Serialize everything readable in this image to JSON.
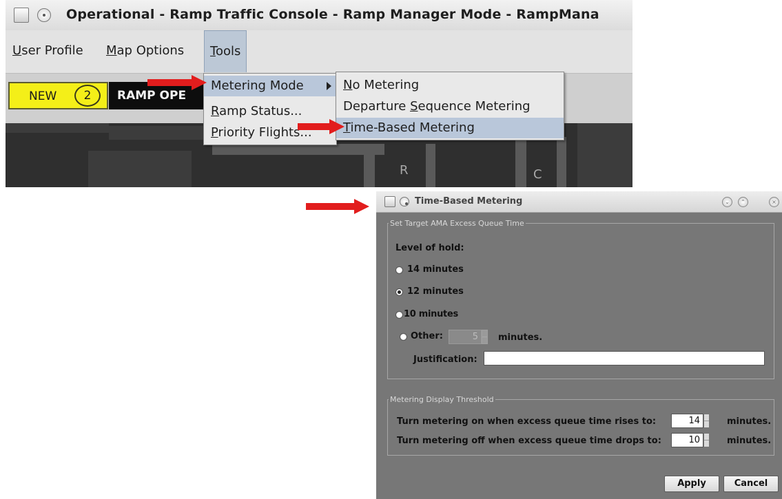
{
  "window": {
    "title": "Operational - Ramp Traffic Console - Ramp Manager Mode - RampMana"
  },
  "menubar": {
    "items": [
      {
        "label": "User Profile",
        "mnemonic": "U"
      },
      {
        "label": "Map Options",
        "mnemonic": "M"
      },
      {
        "label": "Tools",
        "mnemonic": "T"
      }
    ]
  },
  "toolbar": {
    "new_label": "NEW",
    "new_count": "2",
    "ramp_label": "RAMP OPE"
  },
  "map": {
    "labels": [
      "R",
      "C"
    ]
  },
  "tools_menu": {
    "items": [
      {
        "label": "Metering Mode",
        "has_submenu": true
      },
      {
        "label": "Ramp Status..."
      },
      {
        "label": "Priority Flights..."
      }
    ]
  },
  "metering_submenu": {
    "items": [
      {
        "label": "No Metering"
      },
      {
        "label": "Departure Sequence Metering"
      },
      {
        "label": "Time-Based Metering",
        "highlighted": true
      }
    ]
  },
  "dialog": {
    "title": "Time-Based Metering",
    "target_group": {
      "title": "Set Target AMA Excess Queue Time",
      "level_label": "Level of hold:",
      "options": [
        {
          "label": "14 minutes",
          "selected": false
        },
        {
          "label": "12 minutes",
          "selected": true
        },
        {
          "label": "10 minutes",
          "selected": false
        }
      ],
      "other_label": "Other:",
      "other_value": "5",
      "other_unit": "minutes.",
      "justification_label": "Justification:",
      "justification_value": ""
    },
    "threshold_group": {
      "title": "Metering Display Threshold",
      "rows": [
        {
          "label": "Turn metering on when excess queue time rises to:",
          "value": "14",
          "unit": "minutes."
        },
        {
          "label": "Turn metering off when excess queue time drops to:",
          "value": "10",
          "unit": "minutes."
        }
      ]
    },
    "buttons": {
      "apply": "Apply",
      "cancel": "Cancel"
    }
  },
  "colors": {
    "arrow": "#e21d1d",
    "menu_highlight": "#b9c7da",
    "badge_yellow": "#f4ef18",
    "dialog_bg": "#777777"
  },
  "icons": [
    "java-app-icon",
    "window-menu-icon",
    "submenu-arrow-icon",
    "minimize-icon",
    "maximize-icon",
    "close-icon",
    "spinner-up-icon",
    "spinner-down-icon"
  ]
}
